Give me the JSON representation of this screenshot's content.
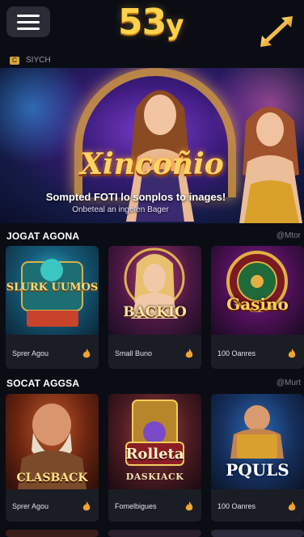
{
  "header": {
    "logo_main": "53",
    "logo_suffix": "y"
  },
  "subbar": {
    "chip": "C",
    "text": "SIYCH"
  },
  "banner": {
    "title": "Xincoñio",
    "subtitle": "Sompted FOTI lo sonplos to inages!",
    "tagline": "Onbeteal an ingefen Bager"
  },
  "sections": [
    {
      "title": "JOGAT AGONA",
      "more": "@Mtor",
      "cards": [
        {
          "art_label": "SLURK UUMOS",
          "caption": "Sprer Agou"
        },
        {
          "art_label": "BACKIO",
          "caption": "Small Buno"
        },
        {
          "art_label": "Gasino",
          "caption": "100 Oanres"
        }
      ]
    },
    {
      "title": "SOCAT AGGSA",
      "more": "@Murt",
      "cards": [
        {
          "art_label": "CLASBACK",
          "caption": "Sprer Agou"
        },
        {
          "art_label": "Rolleta",
          "art_sub": "DASKIACK",
          "caption": "Fomelbigues"
        },
        {
          "art_label": "PQULS",
          "caption": "100 Oanres"
        }
      ]
    }
  ],
  "colors": {
    "background": "#0b0d14",
    "card": "#1b1d25",
    "logo": "#ffd24a",
    "accent_flame": "#f0a531"
  }
}
